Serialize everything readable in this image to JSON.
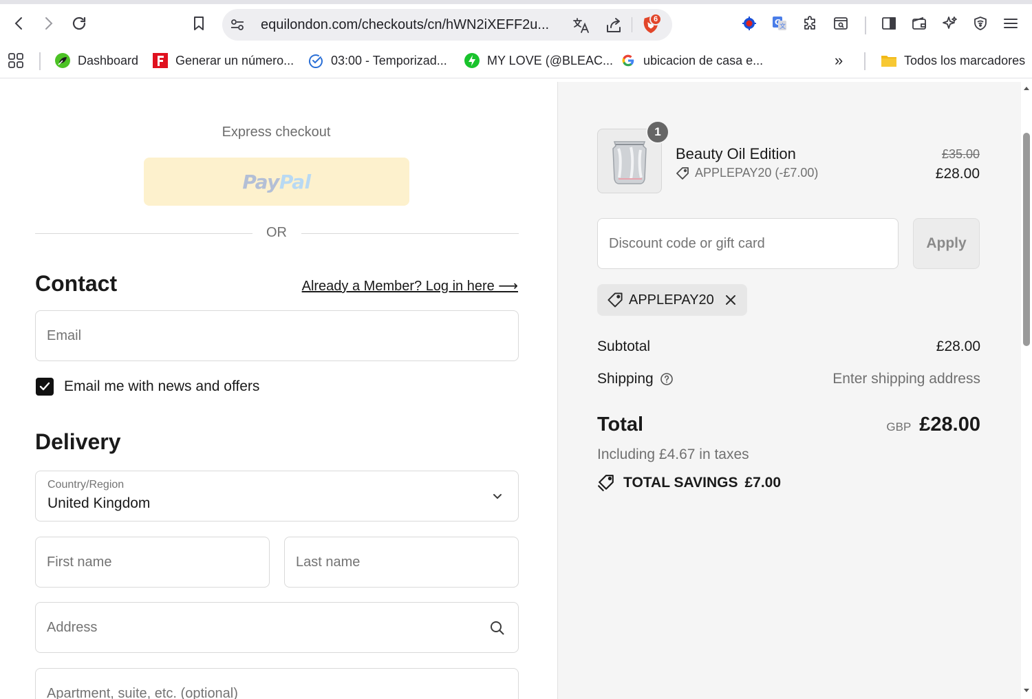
{
  "browser": {
    "url": "equilondon.com/checkouts/cn/hWN2iXEFF2u...",
    "shields_count": "6"
  },
  "bookmarks": {
    "items": [
      {
        "label": "Dashboard",
        "icon": "leaf-icon"
      },
      {
        "label": "Generar un número...",
        "icon": "f-icon"
      },
      {
        "label": "03:00 - Temporizad...",
        "icon": "timer-check-icon"
      },
      {
        "label": "MY LOVE (@BLEAC...",
        "icon": "bolt-icon"
      },
      {
        "label": "ubicacion de casa e...",
        "icon": "google-icon"
      }
    ],
    "overflow": "»",
    "all_bookmarks": "Todos los marcadores"
  },
  "checkout": {
    "express_label": "Express checkout",
    "paypal_pay": "Pay",
    "paypal_pal": "Pal",
    "or_label": "OR",
    "contact_heading": "Contact",
    "login_link": "Already a Member? Log in here ⟶",
    "email_placeholder": "Email",
    "newsletter_label": "Email me with news and offers",
    "newsletter_checked": true,
    "delivery_heading": "Delivery",
    "country_label": "Country/Region",
    "country_value": "United Kingdom",
    "first_name_placeholder": "First name",
    "last_name_placeholder": "Last name",
    "address_placeholder": "Address",
    "apartment_placeholder": "Apartment, suite, etc. (optional)"
  },
  "summary": {
    "quantity": "1",
    "product_name": "Beauty Oil Edition",
    "product_discount": "APPLEPAY20 (-£7.00)",
    "price_original": "£35.00",
    "price_discounted": "£28.00",
    "discount_placeholder": "Discount code or gift card",
    "apply_label": "Apply",
    "applied_code": "APPLEPAY20",
    "subtotal_label": "Subtotal",
    "subtotal_value": "£28.00",
    "shipping_label": "Shipping",
    "shipping_value": "Enter shipping address",
    "total_label": "Total",
    "total_currency": "GBP",
    "total_value": "£28.00",
    "tax_note": "Including £4.67 in taxes",
    "savings_label": "TOTAL SAVINGS",
    "savings_value": "£7.00"
  },
  "colors": {
    "paypal_bg": "#fdf1cd",
    "summary_bg": "#f5f5f5",
    "checkbox": "#111111",
    "brave_orange": "#e2462a"
  }
}
